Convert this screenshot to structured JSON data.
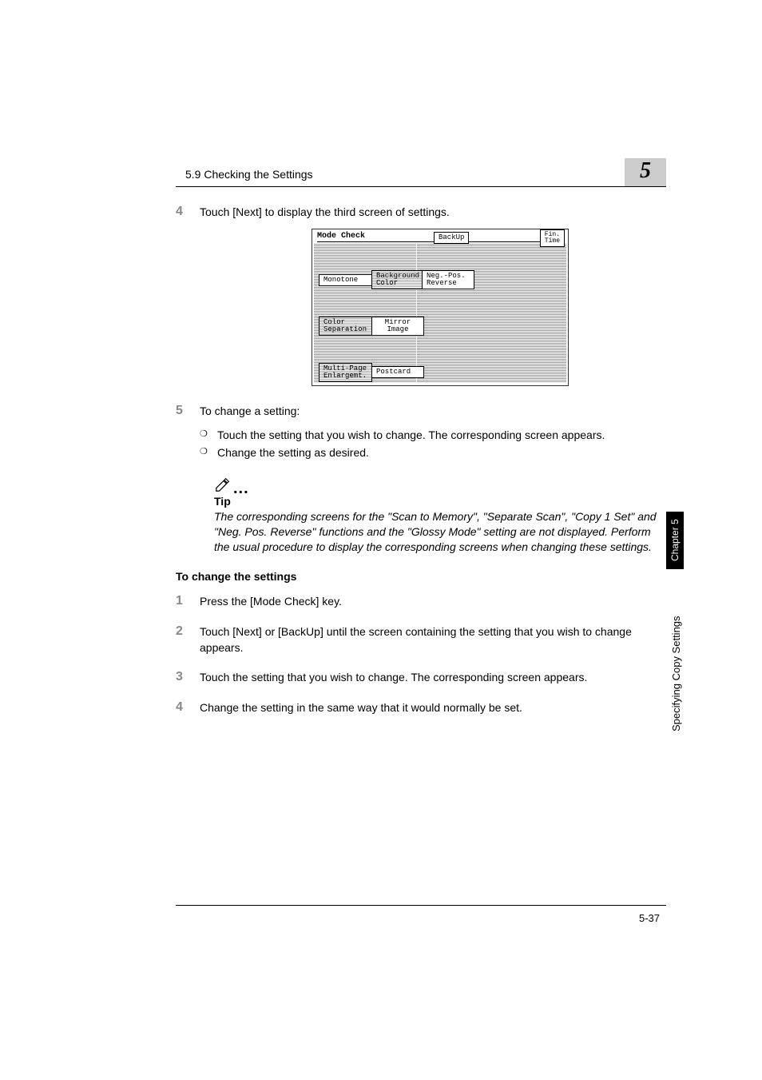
{
  "header": {
    "section_title": "5.9 Checking the Settings"
  },
  "chapter_badge": "5",
  "side_tab": "Chapter 5",
  "side_label": "Specifying Copy Settings",
  "step4": {
    "num": "4",
    "text": "Touch [Next] to display the third screen of settings."
  },
  "screenshot": {
    "title": "Mode Check",
    "backup_btn": "BackUp",
    "fin_btn": "Fin.\nTime",
    "buttons": {
      "monotone": "Monotone",
      "background_color": "Background\nColor",
      "neg_pos": "Neg.-Pos.\nReverse",
      "color_separation": "Color\nSeparation",
      "mirror_image": "Mirror\nImage",
      "multi_page": "Multi-Page\nEnlargemt.",
      "postcard": "Postcard"
    }
  },
  "step5": {
    "num": "5",
    "text": "To change a setting:",
    "sub1": "Touch the setting that you wish to change. The corresponding screen appears.",
    "sub2": "Change the setting as desired."
  },
  "tip": {
    "label": "Tip",
    "text": "The corresponding screens for the \"Scan to Memory\", \"Separate Scan\", \"Copy 1 Set\" and \"Neg. Pos. Reverse\" functions and the \"Glossy Mode\" setting are not displayed. Perform the usual procedure to display the corresponding screens when changing these settings."
  },
  "section2_heading": "To change the settings",
  "s2_step1": {
    "num": "1",
    "text": "Press the [Mode Check] key."
  },
  "s2_step2": {
    "num": "2",
    "text": "Touch [Next] or [BackUp] until the screen containing the setting that you wish to change appears."
  },
  "s2_step3": {
    "num": "3",
    "text": "Touch the setting that you wish to change. The corresponding screen appears."
  },
  "s2_step4": {
    "num": "4",
    "text": "Change the setting in the same way that it would normally be set."
  },
  "page_number": "5-37"
}
